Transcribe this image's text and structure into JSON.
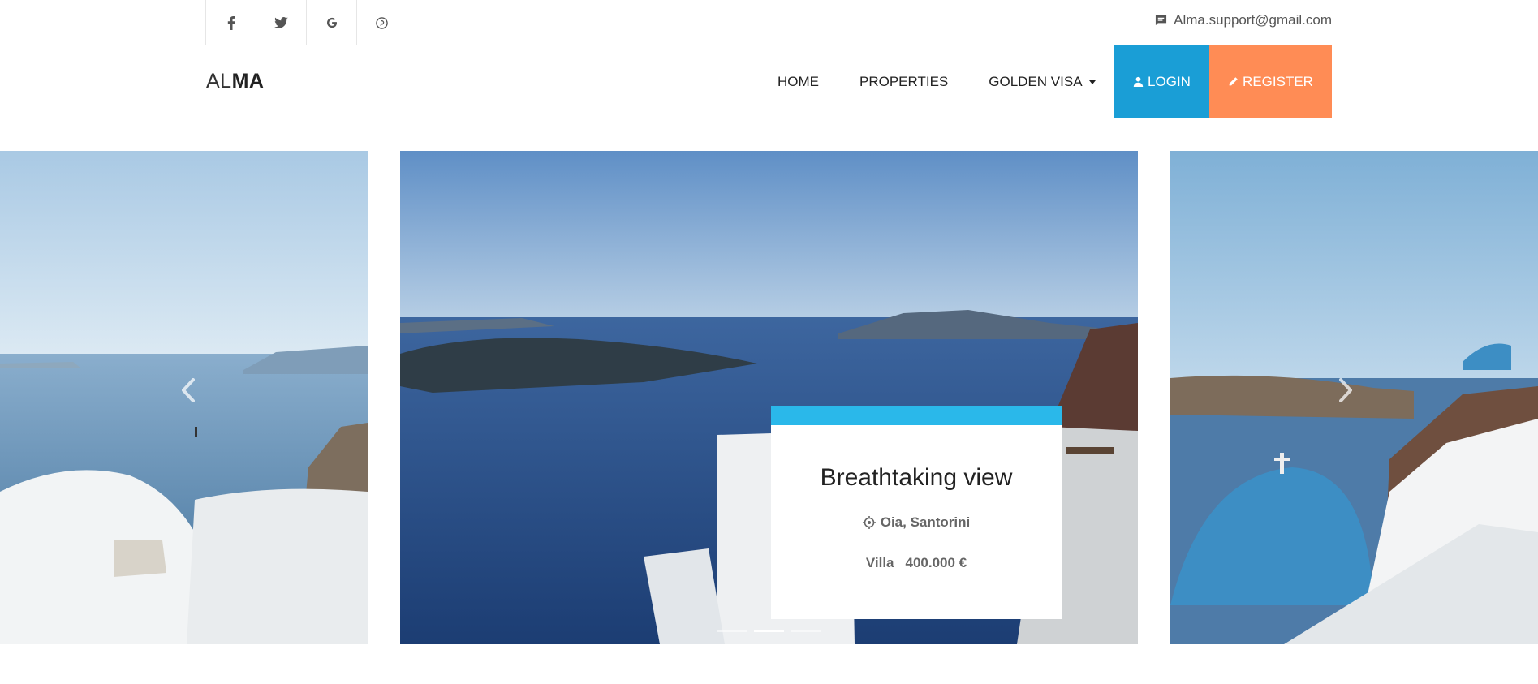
{
  "topbar": {
    "social": [
      {
        "icon": "facebook-icon",
        "glyph": "f"
      },
      {
        "icon": "twitter-icon",
        "glyph": "🐦"
      },
      {
        "icon": "google-icon",
        "glyph": "G"
      },
      {
        "icon": "pinterest-icon",
        "glyph": "℗"
      }
    ],
    "email": "Alma.support@gmail.com"
  },
  "nav": {
    "logo_light": "AL",
    "logo_bold": "MA",
    "items": [
      "HOME",
      "PROPERTIES",
      "GOLDEN VISA"
    ],
    "login": "LOGIN",
    "register": "REGISTER"
  },
  "carousel": {
    "card": {
      "title": "Breathtaking view",
      "location": "Oia, Santorini",
      "type": "Villa",
      "price": "400.000 €"
    },
    "indicators": {
      "count": 3,
      "active": 1
    }
  },
  "colors": {
    "login": "#1a9ed6",
    "register": "#ff8c55",
    "card_accent": "#2ab8ea"
  }
}
